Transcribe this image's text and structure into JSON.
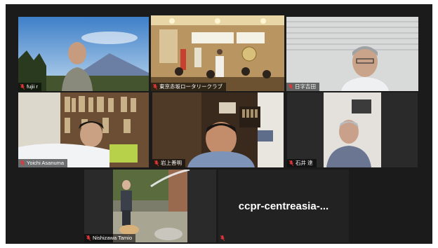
{
  "meeting": {
    "active_speaker": "東京赤坂ロータリークラブ",
    "participants": [
      {
        "name": "fujii r",
        "muted": true
      },
      {
        "name": "東京赤坂ロータリークラブ",
        "muted": true,
        "active": true
      },
      {
        "name": "日字吉田",
        "muted": true
      },
      {
        "name": "Yoichi Asanuma",
        "muted": true
      },
      {
        "name": "岩上善明",
        "muted": true
      },
      {
        "name": "石井 達",
        "muted": true
      },
      {
        "name": "Nishizawa Tamio",
        "muted": true
      },
      {
        "name": "",
        "muted": true,
        "video_off": true,
        "display_name": "ccpr-centreasia-..."
      }
    ]
  },
  "colors": {
    "stage_bg": "#1b1b1b",
    "active_border": "#e6ef3a",
    "muted_icon": "#e0363a"
  },
  "icons": {
    "muted": "mic-off-icon"
  }
}
